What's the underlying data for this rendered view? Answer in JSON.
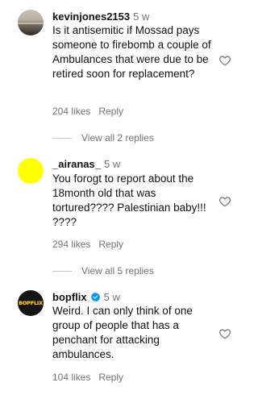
{
  "comments": [
    {
      "username": "kevinjones2153",
      "time": "5 w",
      "text": "Is it antisemitic if Mossad pays someone to firebomb a couple of Ambulances that were due to be retired soon for replacement?",
      "likes": "204 likes",
      "reply_label": "Reply",
      "view_replies": "View all 2 replies"
    },
    {
      "username": "_airanas_",
      "time": "5 w",
      "text": "You forogt to report about the 18month old that was tortured???? Palestinian baby!!! ????",
      "likes": "294 likes",
      "reply_label": "Reply",
      "view_replies": "View all 5 replies"
    },
    {
      "username": "bopflix",
      "time": "5 w",
      "text": "Weird. I can only think of one group of people that has a penchant for attacking ambulances.",
      "likes": "104 likes",
      "reply_label": "Reply",
      "avatar_text": "BOPFLIX"
    }
  ],
  "colors": {
    "secondary_text": "#737373",
    "verified_blue": "#0095f6",
    "avatar_yellow": "#ffff00"
  },
  "icons": {
    "like": "heart-outline-icon",
    "verified": "verified-badge-icon"
  }
}
